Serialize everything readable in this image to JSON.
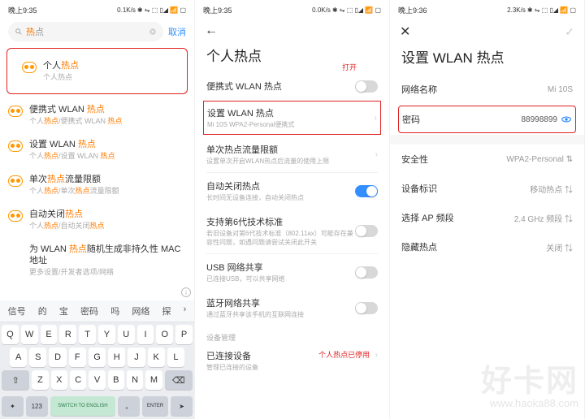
{
  "status": {
    "time1": "晚上9:35",
    "net1": "0.1K/s",
    "time2": "晚上9:35",
    "net2": "0.0K/s",
    "time3": "晚上9:36",
    "net3": "2.3K/s",
    "icons": "✱ ⇋ ⬚ ▯◢ 📶 ▢"
  },
  "s1": {
    "search_prefix": "热",
    "search_suffix": "点",
    "cancel": "取消",
    "items": [
      {
        "t1": "个人",
        "t1h": "热点",
        "s": "个人热点"
      },
      {
        "t1": "便携式 WLAN ",
        "t1h": "热点",
        "s": "个人热点/便携式 WLAN 热点"
      },
      {
        "t1": "设置 WLAN ",
        "t1h": "热点",
        "s": "个人热点/设置 WLAN 热点"
      },
      {
        "t1": "单次",
        "t1h": "热点",
        "t2": "流量限额",
        "s": "个人热点/单次热点流量限额"
      },
      {
        "t1": "自动关闭",
        "t1h": "热点",
        "s": "个人热点/自动关闭热点"
      },
      {
        "t1": "为 WLAN ",
        "t1h": "热点",
        "t2": "随机生成非持久性 MAC 地址",
        "s": "更多设置/开发者选项/网络"
      }
    ],
    "sugg": [
      "信号",
      "的",
      "宝",
      "密码",
      "吗",
      "网络",
      "探"
    ],
    "row1": [
      "Q",
      "W",
      "E",
      "R",
      "T",
      "Y",
      "U",
      "I",
      "O",
      "P"
    ],
    "row2": [
      "A",
      "S",
      "D",
      "F",
      "G",
      "H",
      "J",
      "K",
      "L"
    ],
    "row3": [
      "Z",
      "X",
      "C",
      "V",
      "B",
      "N",
      "M"
    ],
    "switch": "SWITCH TO ENGLISH",
    "enter": "ENTER"
  },
  "s2": {
    "title": "个人热点",
    "open": "打开",
    "r0": {
      "l": "便携式 WLAN 热点"
    },
    "r1": {
      "l": "设置 WLAN 热点",
      "d": "Mi 10S WPA2-Personal便携式"
    },
    "r2": {
      "l": "单次热点流量限额",
      "d": "设置单次开启WLAN热点后流量的使用上限"
    },
    "r3": {
      "l": "自动关闭热点",
      "d": "长时间无设备连接，自动关闭热点"
    },
    "r4": {
      "l": "支持第6代技术标准",
      "d": "若旧设备对第6代技术标准（802.11ax）可能存在兼容性问题，如遇问题请尝试关闭此开关"
    },
    "r5": {
      "l": "USB 网络共享",
      "d": "已连接USB，可以共享网络"
    },
    "r6": {
      "l": "蓝牙网络共享",
      "d": "通过蓝牙共享该手机的互联网连接"
    },
    "sec": "设备管理",
    "conn": {
      "l": "已连接设备",
      "d": "管理已连接的设备",
      "v": "个人热点已停用"
    }
  },
  "s3": {
    "title": "设置 WLAN 热点",
    "r1": {
      "l": "网络名称",
      "v": "Mi 10S"
    },
    "r2": {
      "l": "密码",
      "v": "88998899"
    },
    "r3": {
      "l": "安全性",
      "v": "WPA2-Personal"
    },
    "r4": {
      "l": "设备标识",
      "v": "移动热点"
    },
    "r5": {
      "l": "选择 AP 频段",
      "v": "2.4 GHz 频段"
    },
    "r6": {
      "l": "隐藏热点",
      "v": "关闭"
    }
  },
  "wm": {
    "main": "好卡网",
    "sub": "www.haoka88.com"
  }
}
